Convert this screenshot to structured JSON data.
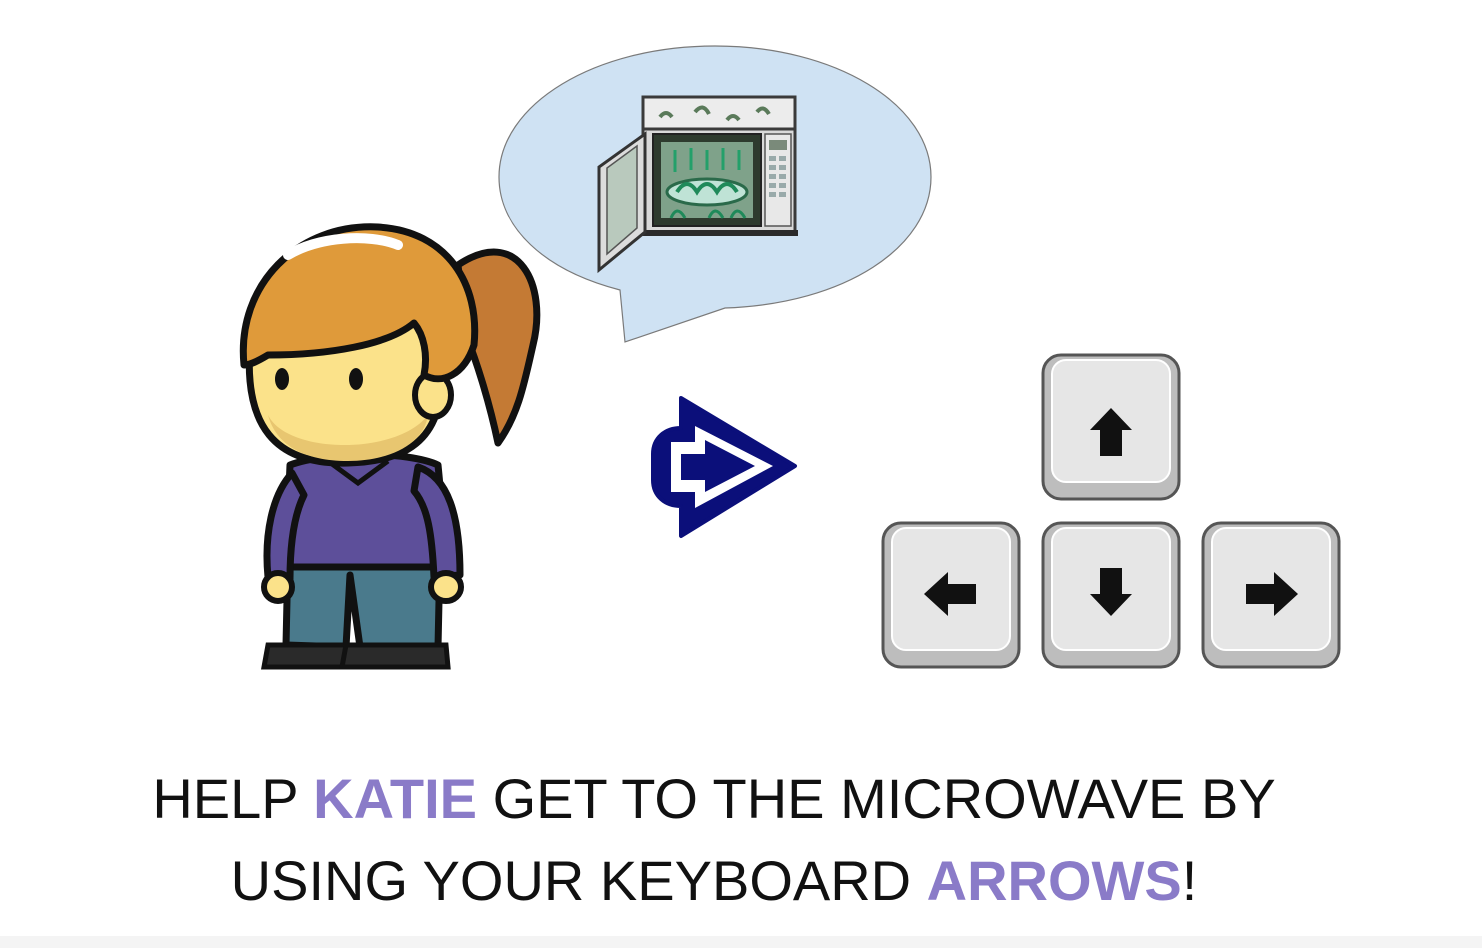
{
  "colors": {
    "highlight": "#8a7bc8",
    "text": "#111111",
    "bubble_fill": "#cfe2f3",
    "cue_arrow": "#0b0f7a",
    "key_face": "#e6e6e6"
  },
  "scene": {
    "character_icon": "katie-character",
    "thought_icon": "microwave-icon",
    "cue_icon": "right-arrow-cue-icon"
  },
  "keys": {
    "up": {
      "glyph": "🡑",
      "icon": "arrow-up-icon"
    },
    "left": {
      "glyph": "🡐",
      "icon": "arrow-left-icon"
    },
    "down": {
      "glyph": "🡓",
      "icon": "arrow-down-icon"
    },
    "right": {
      "glyph": "🡒",
      "icon": "arrow-right-icon"
    }
  },
  "instruction": {
    "line1_a": "HELP ",
    "line1_name": "KATIE",
    "line1_b": " GET TO THE MICROWAVE BY",
    "line2_a": "USING YOUR KEYBOARD ",
    "line2_word": "ARROWS",
    "line2_b": "!"
  }
}
